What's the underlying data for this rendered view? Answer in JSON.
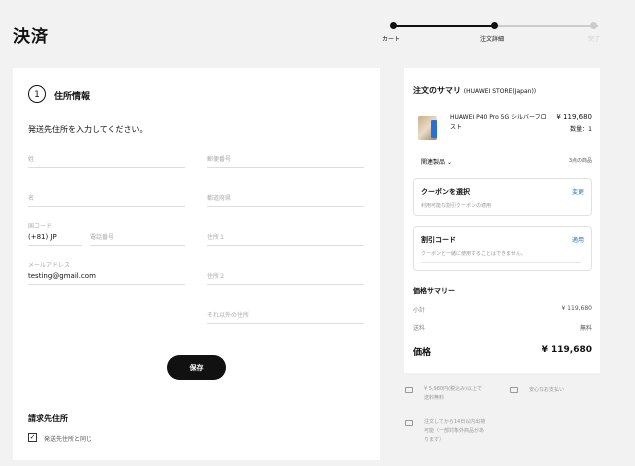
{
  "page": {
    "title": "決済"
  },
  "stepper": {
    "steps": [
      "カート",
      "注文詳細",
      "完了"
    ],
    "current": 2
  },
  "address": {
    "step_number": "1",
    "title": "住所情報",
    "instruction": "発送先住所を入力してください。",
    "fields": {
      "last_name": "姓",
      "postal_code": "郵便番号",
      "first_name": "名",
      "prefecture": "都道府県",
      "country_code_label": "国コード",
      "country_code_value": "(+81) JP",
      "phone": "電話番号",
      "address1": "住所１",
      "email_label": "メールアドレス",
      "email_value": "testing@gmail.com",
      "address2": "住所２",
      "other_address": "それ以外の住所"
    },
    "save_label": "保存"
  },
  "billing": {
    "title": "請求先住所",
    "same_as_shipping": "発送先住所と同じ",
    "checked": true
  },
  "summary": {
    "title": "注文のサマリ",
    "store": "(HUAWEI STORE(Japan))",
    "product": {
      "name": "HUAWEI P40 Pro 5G シルバーフロスト",
      "price": "¥ 119,680",
      "qty": "数量：1"
    },
    "related": {
      "label": "関連製品",
      "count": "3点の商品"
    },
    "coupon": {
      "title": "クーポンを選択",
      "action": "変更",
      "desc": "利用可能な割引クーポンの適用"
    },
    "discount": {
      "title": "割引コード",
      "action": "適用",
      "desc": "クーポンと一緒に使用することはできません。"
    },
    "price_summary": "価格サマリー",
    "subtotal_label": "小計",
    "subtotal_value": "¥ 119,680",
    "shipping_label": "送料",
    "shipping_value": "無料",
    "total_label": "価格",
    "total_value": "¥ 119,680"
  },
  "benefits": {
    "shipping_line1": "¥ 5,980円(税込み)以上で",
    "shipping_line2": "送料無料",
    "secure": "安心なお支払い",
    "delivery_line1": "注文してから14日以内出荷",
    "delivery_line2": "可能（一部対象外商品があ",
    "delivery_line3": "ります）"
  },
  "colors": {
    "accent": "#2a72d6",
    "dark": "#111111"
  }
}
